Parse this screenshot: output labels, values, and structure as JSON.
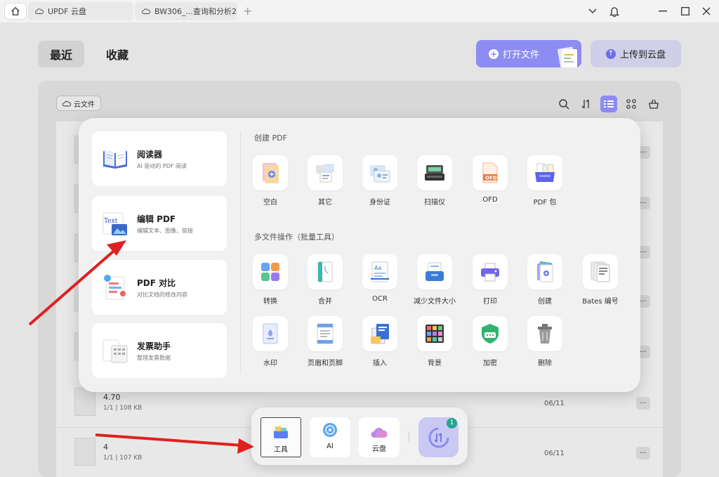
{
  "titlebar": {
    "tabs": [
      {
        "label": "UPDF 云盘"
      },
      {
        "label": "BW306_...查询和分析2"
      }
    ],
    "add_tab": "+"
  },
  "header": {
    "recent": "最近",
    "favorites": "收藏",
    "open_file": "打开文件",
    "upload_cloud": "上传到云盘"
  },
  "panel": {
    "cloud_chip": "云文件"
  },
  "files": [
    {
      "name": "4.70",
      "meta": "1/1 | 108 KB",
      "date": "06/11",
      "more": "···"
    },
    {
      "name": "4",
      "meta": "1/1 | 107 KB",
      "date": "06/11",
      "more": "···"
    }
  ],
  "row_more": "···",
  "popup": {
    "cards": [
      {
        "title": "阅读器",
        "subtitle": "AI 驱动的 PDF 阅读"
      },
      {
        "title": "编辑 PDF",
        "subtitle": "编辑文本、图像、链接"
      },
      {
        "title": "PDF 对比",
        "subtitle": "对比文档的修改内容"
      },
      {
        "title": "发票助手",
        "subtitle": "整理发票数据"
      }
    ],
    "create_title": "创建 PDF",
    "create_tools": [
      {
        "label": "空白",
        "icon": "blank-doc-icon"
      },
      {
        "label": "其它",
        "icon": "other-docs-icon"
      },
      {
        "label": "身份证",
        "icon": "id-card-icon"
      },
      {
        "label": "扫描仪",
        "icon": "scanner-icon"
      },
      {
        "label": "OFD",
        "icon": "ofd-icon"
      },
      {
        "label": "PDF 包",
        "icon": "pdf-package-icon"
      }
    ],
    "batch_title": "多文件操作（批量工具）",
    "batch_tools_row1": [
      {
        "label": "转换",
        "icon": "convert-icon"
      },
      {
        "label": "合并",
        "icon": "merge-icon"
      },
      {
        "label": "OCR",
        "icon": "ocr-icon"
      },
      {
        "label": "减少文件大小",
        "icon": "compress-icon"
      },
      {
        "label": "打印",
        "icon": "print-icon"
      },
      {
        "label": "创建",
        "icon": "create-icon"
      },
      {
        "label": "Bates 编号",
        "icon": "bates-icon"
      }
    ],
    "batch_tools_row2": [
      {
        "label": "水印",
        "icon": "watermark-icon"
      },
      {
        "label": "页眉和页脚",
        "icon": "header-footer-icon"
      },
      {
        "label": "插入",
        "icon": "insert-icon"
      },
      {
        "label": "背景",
        "icon": "background-icon"
      },
      {
        "label": "加密",
        "icon": "encrypt-icon"
      },
      {
        "label": "删除",
        "icon": "delete-icon"
      }
    ],
    "ofd_text": "OFD",
    "ocr_text": "Aa",
    "edit_text": "Text"
  },
  "dock": {
    "tools": "工具",
    "ai": "AI",
    "cloud": "云盘",
    "sync_badge": "1"
  },
  "colors": {
    "accent": "#8d8cf2",
    "annotation_arrow": "#e02020"
  }
}
